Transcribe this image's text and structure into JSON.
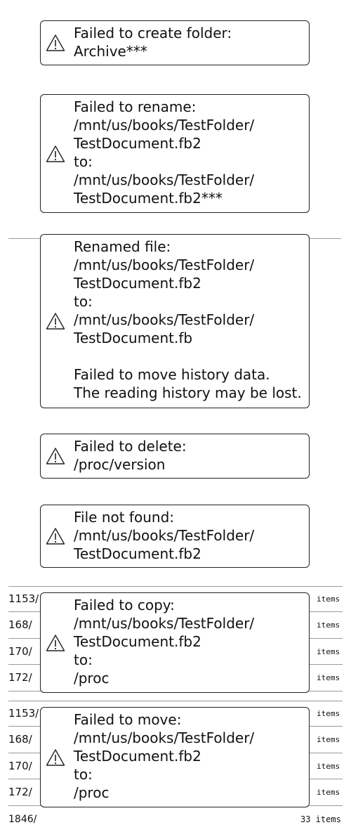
{
  "dialogs": [
    {
      "icon": "warning-icon",
      "message": "Failed to create folder:\nArchive***"
    },
    {
      "icon": "warning-icon",
      "message": "Failed to rename:\n/mnt/us/books/TestFolder/\nTestDocument.fb2\nto:\n/mnt/us/books/TestFolder/\nTestDocument.fb2***"
    },
    {
      "icon": "warning-icon",
      "message": "Renamed file:\n/mnt/us/books/TestFolder/\nTestDocument.fb2\nto:\n/mnt/us/books/TestFolder/\nTestDocument.fb\n\nFailed to move history data.\nThe reading history may be lost."
    },
    {
      "icon": "warning-icon",
      "message": "Failed to delete:\n/proc/version"
    },
    {
      "icon": "warning-icon",
      "message": "File not found:\n/mnt/us/books/TestFolder/\nTestDocument.fb2"
    },
    {
      "icon": "warning-icon",
      "message": "Failed to copy:\n/mnt/us/books/TestFolder/\nTestDocument.fb2\nto:\n/proc"
    },
    {
      "icon": "warning-icon",
      "message": "Failed to move:\n/mnt/us/books/TestFolder/\nTestDocument.fb2\nto:\n/proc"
    }
  ],
  "file_list_1": [
    {
      "name": "1153/",
      "count": "items"
    },
    {
      "name": "168/",
      "count": "items"
    },
    {
      "name": "170/",
      "count": "items"
    },
    {
      "name": "172/",
      "count": "items"
    }
  ],
  "file_list_2": [
    {
      "name": "1153/",
      "count": "items"
    },
    {
      "name": "168/",
      "count": "items"
    },
    {
      "name": "170/",
      "count": "items"
    },
    {
      "name": "172/",
      "count": "items"
    }
  ],
  "partial_row": {
    "name": "1846/",
    "count": "33 items"
  }
}
